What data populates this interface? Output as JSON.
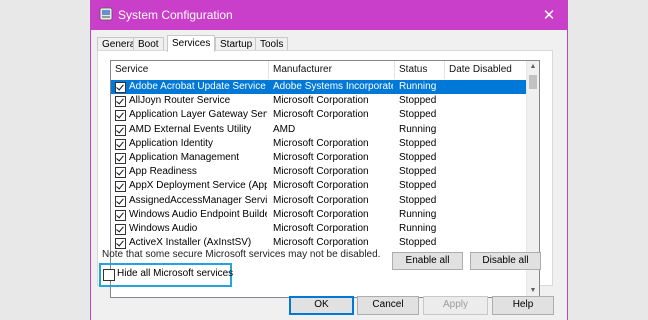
{
  "window": {
    "title": "System Configuration",
    "close_glyph": "✕"
  },
  "tabs": [
    "General",
    "Boot",
    "Services",
    "Startup",
    "Tools"
  ],
  "active_tab": "Services",
  "columns": [
    "Service",
    "Manufacturer",
    "Status",
    "Date Disabled"
  ],
  "services": [
    {
      "name": "Adobe Acrobat Update Service",
      "manufacturer": "Adobe Systems Incorporated",
      "status": "Running",
      "date_disabled": "",
      "checked": true,
      "selected": true
    },
    {
      "name": "AllJoyn Router Service",
      "manufacturer": "Microsoft Corporation",
      "status": "Stopped",
      "date_disabled": "",
      "checked": true
    },
    {
      "name": "Application Layer Gateway Service",
      "manufacturer": "Microsoft Corporation",
      "status": "Stopped",
      "date_disabled": "",
      "checked": true
    },
    {
      "name": "AMD External Events Utility",
      "manufacturer": "AMD",
      "status": "Running",
      "date_disabled": "",
      "checked": true
    },
    {
      "name": "Application Identity",
      "manufacturer": "Microsoft Corporation",
      "status": "Stopped",
      "date_disabled": "",
      "checked": true
    },
    {
      "name": "Application Management",
      "manufacturer": "Microsoft Corporation",
      "status": "Stopped",
      "date_disabled": "",
      "checked": true
    },
    {
      "name": "App Readiness",
      "manufacturer": "Microsoft Corporation",
      "status": "Stopped",
      "date_disabled": "",
      "checked": true
    },
    {
      "name": "AppX Deployment Service (AppX...",
      "manufacturer": "Microsoft Corporation",
      "status": "Stopped",
      "date_disabled": "",
      "checked": true
    },
    {
      "name": "AssignedAccessManager Service",
      "manufacturer": "Microsoft Corporation",
      "status": "Stopped",
      "date_disabled": "",
      "checked": true
    },
    {
      "name": "Windows Audio Endpoint Builder",
      "manufacturer": "Microsoft Corporation",
      "status": "Running",
      "date_disabled": "",
      "checked": true
    },
    {
      "name": "Windows Audio",
      "manufacturer": "Microsoft Corporation",
      "status": "Running",
      "date_disabled": "",
      "checked": true
    },
    {
      "name": "ActiveX Installer (AxInstSV)",
      "manufacturer": "Microsoft Corporation",
      "status": "Stopped",
      "date_disabled": "",
      "checked": true
    }
  ],
  "note": "Note that some secure Microsoft services may not be disabled.",
  "buttons": {
    "enable_all": "Enable all",
    "disable_all": "Disable all",
    "ok": "OK",
    "cancel": "Cancel",
    "apply": "Apply",
    "help": "Help"
  },
  "hide_ms": {
    "label": "Hide all Microsoft services",
    "checked": false
  },
  "colors": {
    "titlebar": "#c93fc9",
    "selection": "#0078d7",
    "highlight": "#24a3dc"
  }
}
